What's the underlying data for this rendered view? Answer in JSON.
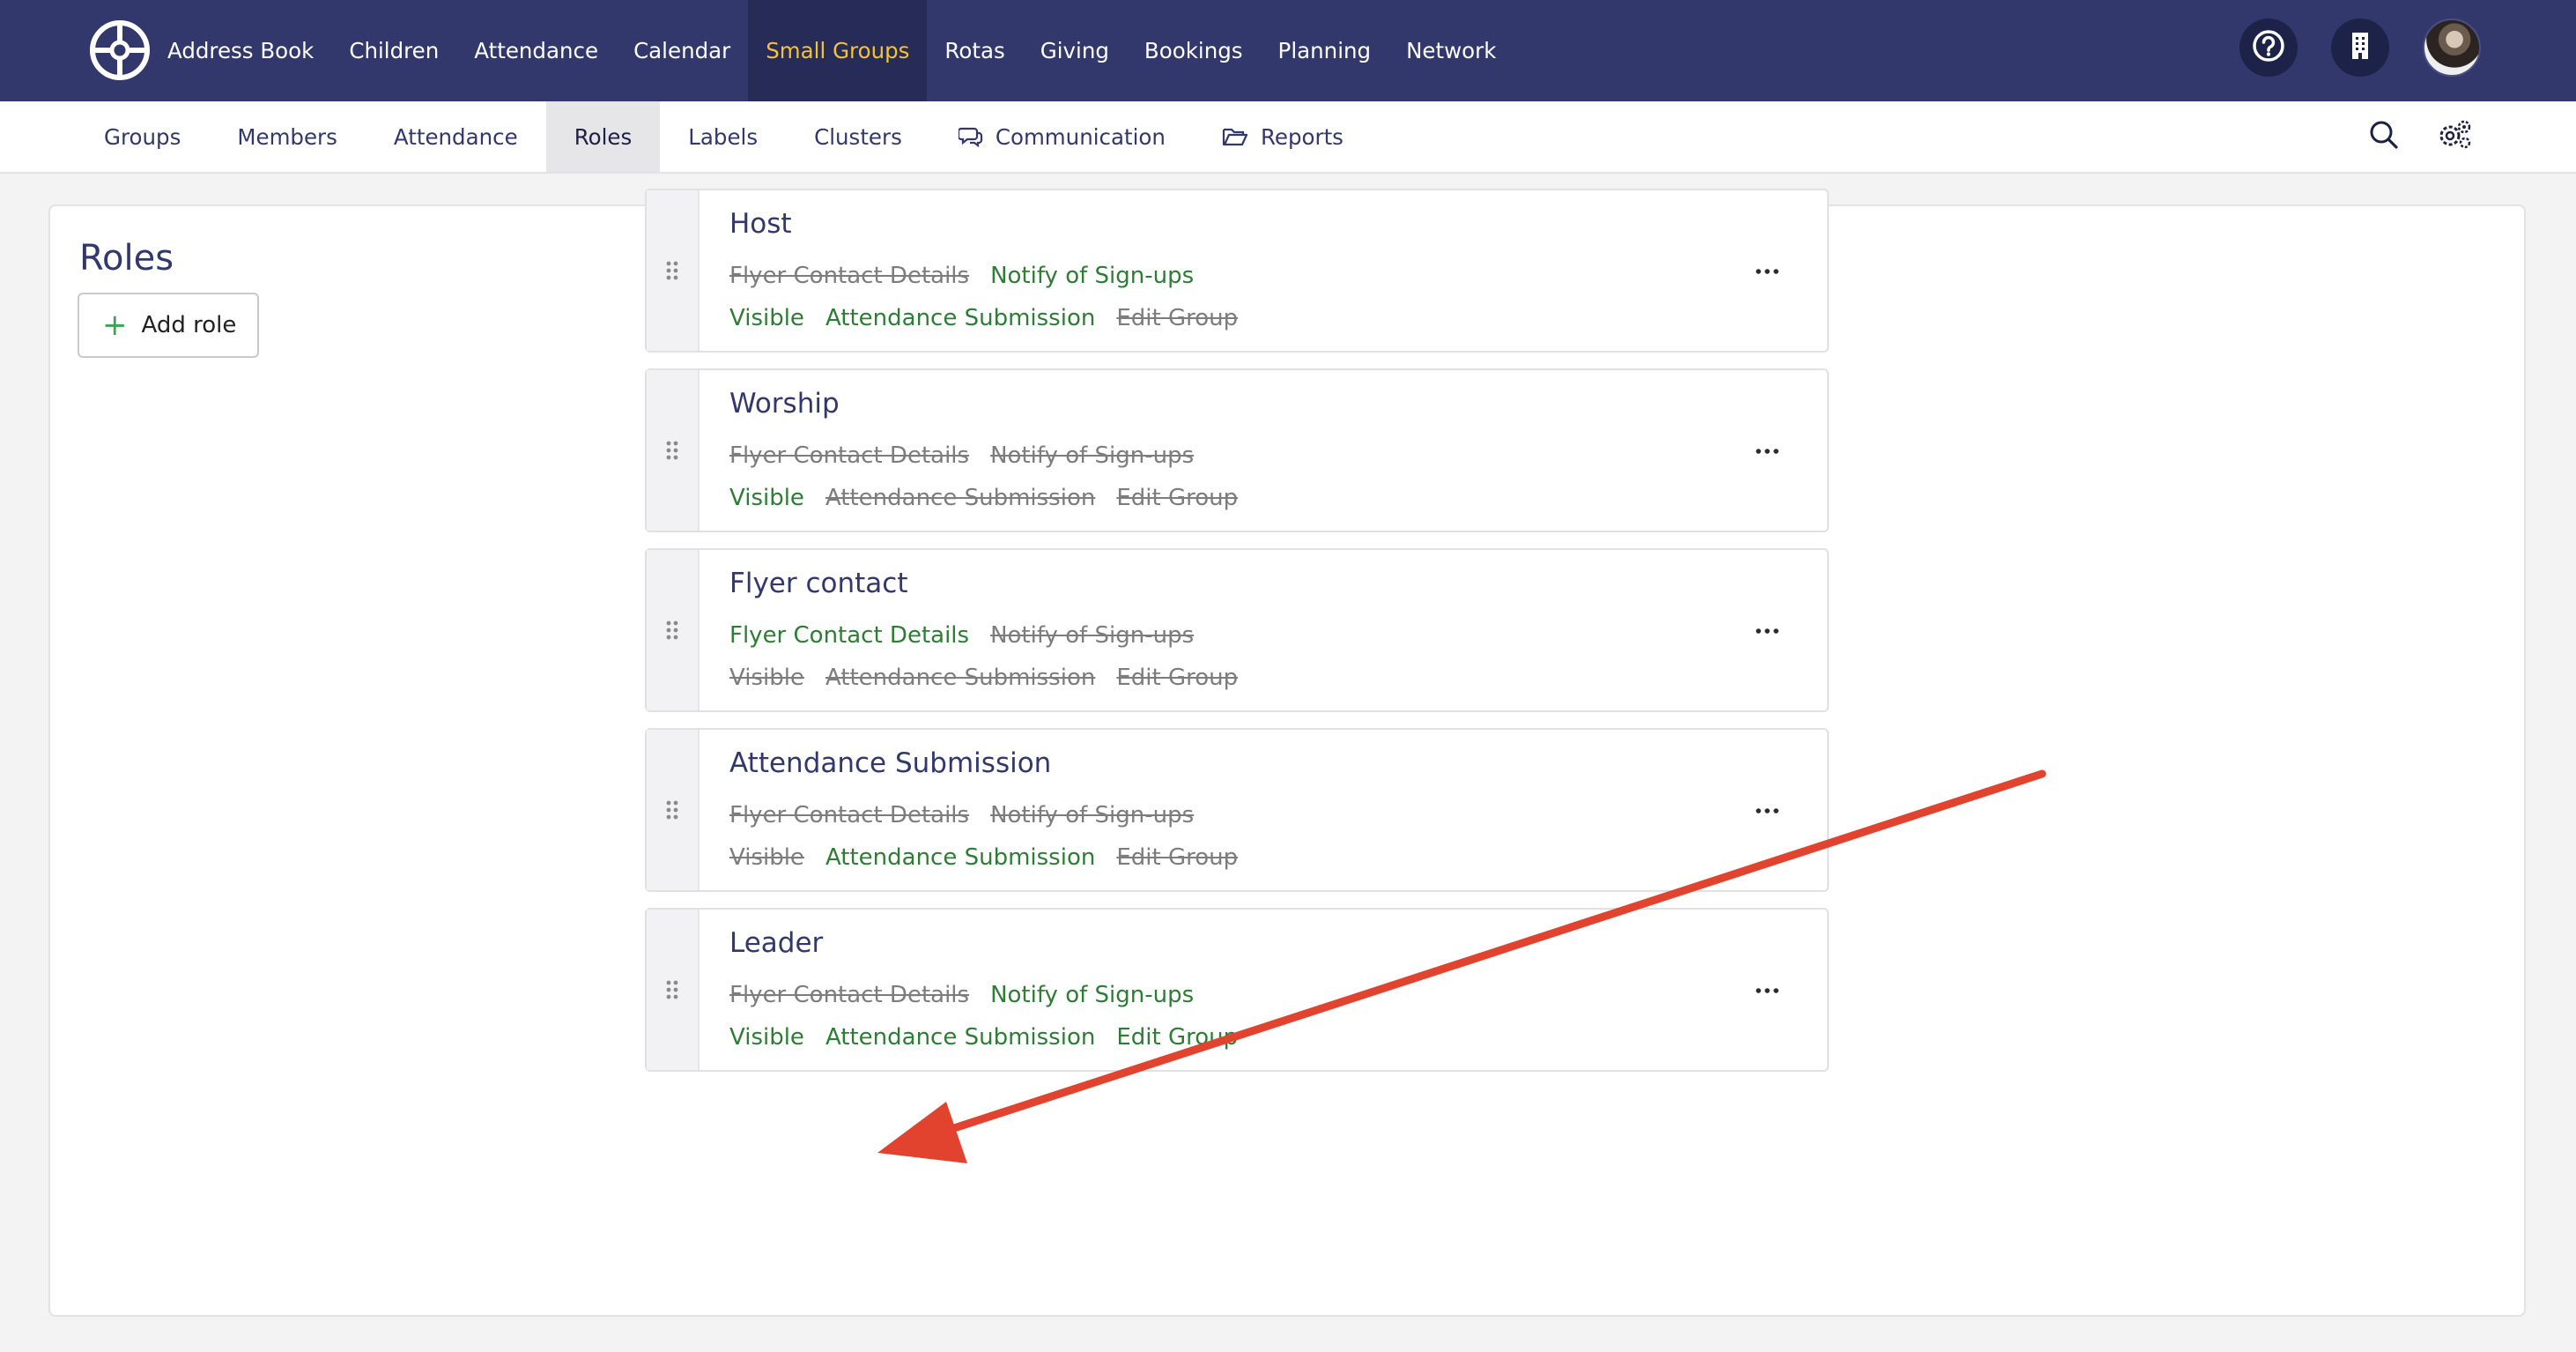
{
  "topnav": {
    "items": [
      {
        "label": "Address Book",
        "active": false
      },
      {
        "label": "Children",
        "active": false
      },
      {
        "label": "Attendance",
        "active": false
      },
      {
        "label": "Calendar",
        "active": false
      },
      {
        "label": "Small Groups",
        "active": true
      },
      {
        "label": "Rotas",
        "active": false
      },
      {
        "label": "Giving",
        "active": false
      },
      {
        "label": "Bookings",
        "active": false
      },
      {
        "label": "Planning",
        "active": false
      },
      {
        "label": "Network",
        "active": false
      }
    ],
    "icons": [
      "logo-icon",
      "help-icon",
      "building-icon",
      "avatar"
    ]
  },
  "subnav": {
    "items": [
      {
        "label": "Groups",
        "active": false,
        "icon": null
      },
      {
        "label": "Members",
        "active": false,
        "icon": null
      },
      {
        "label": "Attendance",
        "active": false,
        "icon": null
      },
      {
        "label": "Roles",
        "active": true,
        "icon": null
      },
      {
        "label": "Labels",
        "active": false,
        "icon": null
      },
      {
        "label": "Clusters",
        "active": false,
        "icon": null
      },
      {
        "label": "Communication",
        "active": false,
        "icon": "chat-icon"
      },
      {
        "label": "Reports",
        "active": false,
        "icon": "folder-icon"
      }
    ],
    "tools": [
      "search-icon",
      "settings-icon"
    ]
  },
  "main": {
    "title": "Roles",
    "add_button": "Add role"
  },
  "roles": [
    {
      "name": "Host",
      "row1": [
        {
          "label": "Flyer Contact Details",
          "enabled": false
        },
        {
          "label": "Notify of Sign-ups",
          "enabled": true
        }
      ],
      "row2": [
        {
          "label": "Visible",
          "enabled": true
        },
        {
          "label": "Attendance Submission",
          "enabled": true
        },
        {
          "label": "Edit Group",
          "enabled": false
        }
      ]
    },
    {
      "name": "Worship",
      "row1": [
        {
          "label": "Flyer Contact Details",
          "enabled": false
        },
        {
          "label": "Notify of Sign-ups",
          "enabled": false
        }
      ],
      "row2": [
        {
          "label": "Visible",
          "enabled": true
        },
        {
          "label": "Attendance Submission",
          "enabled": false
        },
        {
          "label": "Edit Group",
          "enabled": false
        }
      ]
    },
    {
      "name": "Flyer contact",
      "row1": [
        {
          "label": "Flyer Contact Details",
          "enabled": true
        },
        {
          "label": "Notify of Sign-ups",
          "enabled": false
        }
      ],
      "row2": [
        {
          "label": "Visible",
          "enabled": false
        },
        {
          "label": "Attendance Submission",
          "enabled": false
        },
        {
          "label": "Edit Group",
          "enabled": false
        }
      ]
    },
    {
      "name": "Attendance Submission",
      "row1": [
        {
          "label": "Flyer Contact Details",
          "enabled": false
        },
        {
          "label": "Notify of Sign-ups",
          "enabled": false
        }
      ],
      "row2": [
        {
          "label": "Visible",
          "enabled": false
        },
        {
          "label": "Attendance Submission",
          "enabled": true
        },
        {
          "label": "Edit Group",
          "enabled": false
        }
      ]
    },
    {
      "name": "Leader",
      "row1": [
        {
          "label": "Flyer Contact Details",
          "enabled": false
        },
        {
          "label": "Notify of Sign-ups",
          "enabled": true
        }
      ],
      "row2": [
        {
          "label": "Visible",
          "enabled": true
        },
        {
          "label": "Attendance Submission",
          "enabled": true
        },
        {
          "label": "Edit Group",
          "enabled": true
        }
      ]
    }
  ],
  "colors": {
    "nav_bg": "#32386b",
    "nav_active_text": "#f3c23a",
    "enabled": "#2d7d35",
    "disabled": "#7d7d7d",
    "annotation_arrow": "#e2432e"
  }
}
